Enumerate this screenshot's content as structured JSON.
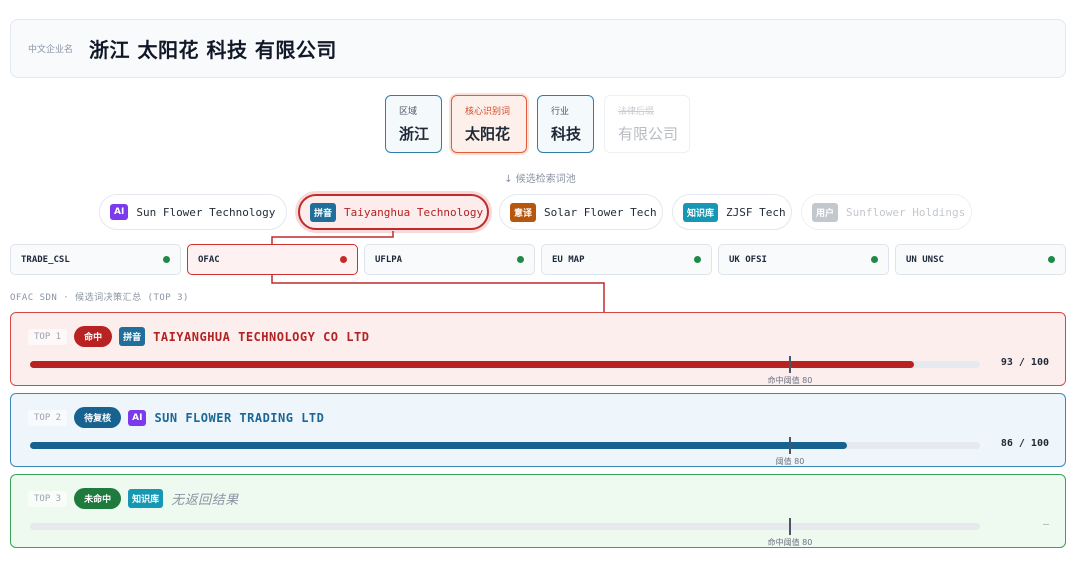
{
  "header": {
    "label": "中文企业名",
    "name": "浙江 太阳花 科技 有限公司"
  },
  "tokens": [
    {
      "label": "区域",
      "value": "浙江"
    },
    {
      "label": "核心识别词",
      "value": "太阳花"
    },
    {
      "label": "行业",
      "value": "科技"
    },
    {
      "label": "法律后缀",
      "value": "有限公司"
    }
  ],
  "candidate_pool_caption": "↓ 候选检索词池",
  "candidates": [
    {
      "badge": "AI",
      "text": "Sun Flower Technology",
      "badge_color": "#7c3aed"
    },
    {
      "badge": "拼音",
      "text": "Taiyanghua Technology",
      "badge_color": "#1f6f9a"
    },
    {
      "badge": "意译",
      "text": "Solar Flower Tech",
      "badge_color": "#b8560e"
    },
    {
      "badge": "知识库",
      "text": "ZJSF Tech",
      "badge_color": "#1698b4"
    },
    {
      "badge": "用户",
      "text": "Sunflower Holdings",
      "badge_color": "#c3c8ce"
    }
  ],
  "lists": [
    {
      "name": "TRADE_CSL",
      "status_color": "#1d8a47"
    },
    {
      "name": "OFAC",
      "status_color": "#c52a2a"
    },
    {
      "name": "UFLPA",
      "status_color": "#1d8a47"
    },
    {
      "name": "EU MAP",
      "status_color": "#1d8a47"
    },
    {
      "name": "UK OFSI",
      "status_color": "#1d8a47"
    },
    {
      "name": "UN UNSC",
      "status_color": "#1d8a47"
    }
  ],
  "section_caption": "OFAC SDN · 候选词决策汇总 (TOP 3)",
  "results": [
    {
      "rank": "TOP 1",
      "status": "命中",
      "source_badge": "拼音",
      "name": "TAIYANGHUA TECHNOLOGY CO LTD",
      "score": 93,
      "score_text": "93 / 100",
      "threshold": 80,
      "threshold_label": "命中阈值 80"
    },
    {
      "rank": "TOP 2",
      "status": "待复核",
      "source_badge": "AI",
      "name": "SUN FLOWER TRADING LTD",
      "score": 86,
      "score_text": "86 / 100",
      "threshold": 80,
      "threshold_label": "阈值 80"
    },
    {
      "rank": "TOP 3",
      "status": "未命中",
      "source_badge": "知识库",
      "name": "无返回结果",
      "score": 0,
      "score_text": "—",
      "threshold": 80,
      "threshold_label": "命中阈值 80"
    }
  ],
  "colors": {
    "hit": "#b82222",
    "review": "#18628f",
    "miss": "#1f7a3d",
    "accent": "#e35a3c"
  }
}
